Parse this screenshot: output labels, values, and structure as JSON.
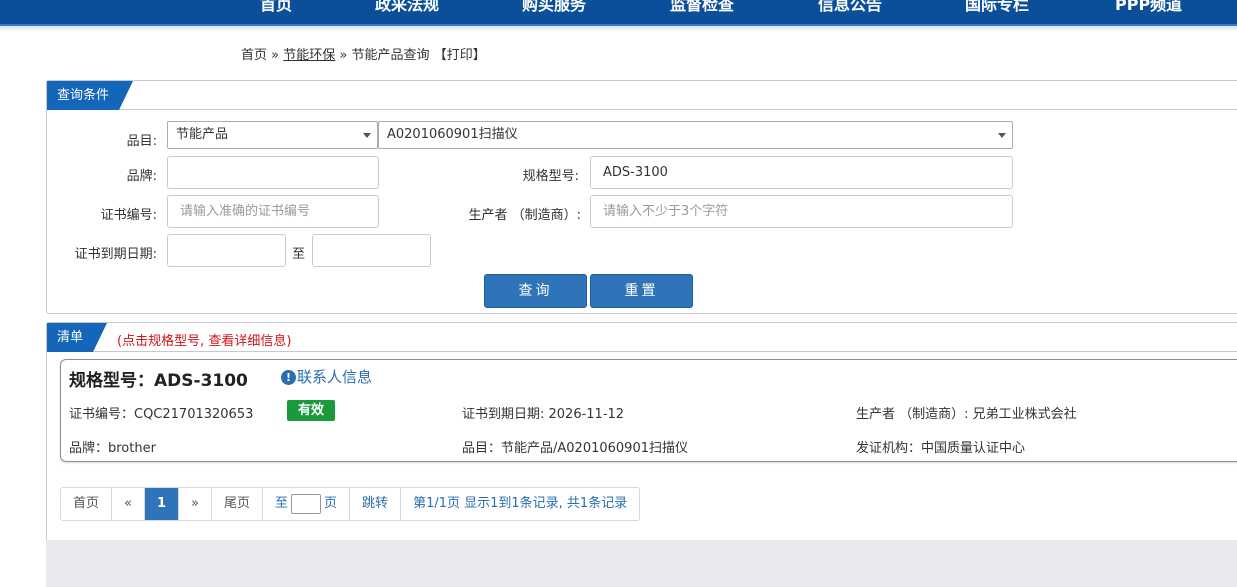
{
  "nav": {
    "items": [
      "首页",
      "政采法规",
      "购买服务",
      "监督检查",
      "信息公告",
      "国际专栏",
      "PPP频道"
    ]
  },
  "breadcrumb": {
    "home": "首页",
    "sep1": "»",
    "section": "节能环保",
    "sep2": "»",
    "current": "节能产品查询",
    "print": "【打印】"
  },
  "query": {
    "header": "查询条件",
    "category_label": "品目:",
    "category_value": "节能产品",
    "subcategory_value": "A0201060901扫描仪",
    "brand_label": "品牌:",
    "brand_value": "",
    "model_label": "规格型号:",
    "model_value": "ADS-3100",
    "cert_label": "证书编号:",
    "cert_placeholder": "请输入准确的证书编号",
    "maker_label": "生产者 （制造商）:",
    "maker_placeholder": "请输入不少于3个字符",
    "expire_label": "证书到期日期:",
    "to_label": "至",
    "search_button": "查询",
    "reset_button": "重置"
  },
  "list": {
    "header": "清单",
    "note": "(点击规格型号, 查看详细信息)"
  },
  "result": {
    "title": "规格型号：ADS-3100",
    "contact": "联系人信息",
    "contact_icon": "info-circle-icon",
    "cert_no": "证书编号：CQC21701320653",
    "status": "有效",
    "expire": "证书到期日期: 2026-11-12",
    "maker": "生产者 （制造商）: 兄弟工业株式会社",
    "brand": "品牌：brother",
    "category": "品目：节能产品/A0201060901扫描仪",
    "issuer": "发证机构：中国质量认证中心"
  },
  "pager": {
    "first": "首页",
    "prev": "«",
    "current": "1",
    "next": "»",
    "last": "尾页",
    "goto_prefix": "至",
    "goto_suffix": "页",
    "jump": "跳转",
    "summary": "第1/1页  显示1到1条记录, 共1条记录"
  },
  "colors": {
    "nav": "#0b4f9a",
    "accent": "#1466b8",
    "button": "#2f74b9",
    "valid": "#1a9a3b",
    "note": "#d0141a"
  }
}
